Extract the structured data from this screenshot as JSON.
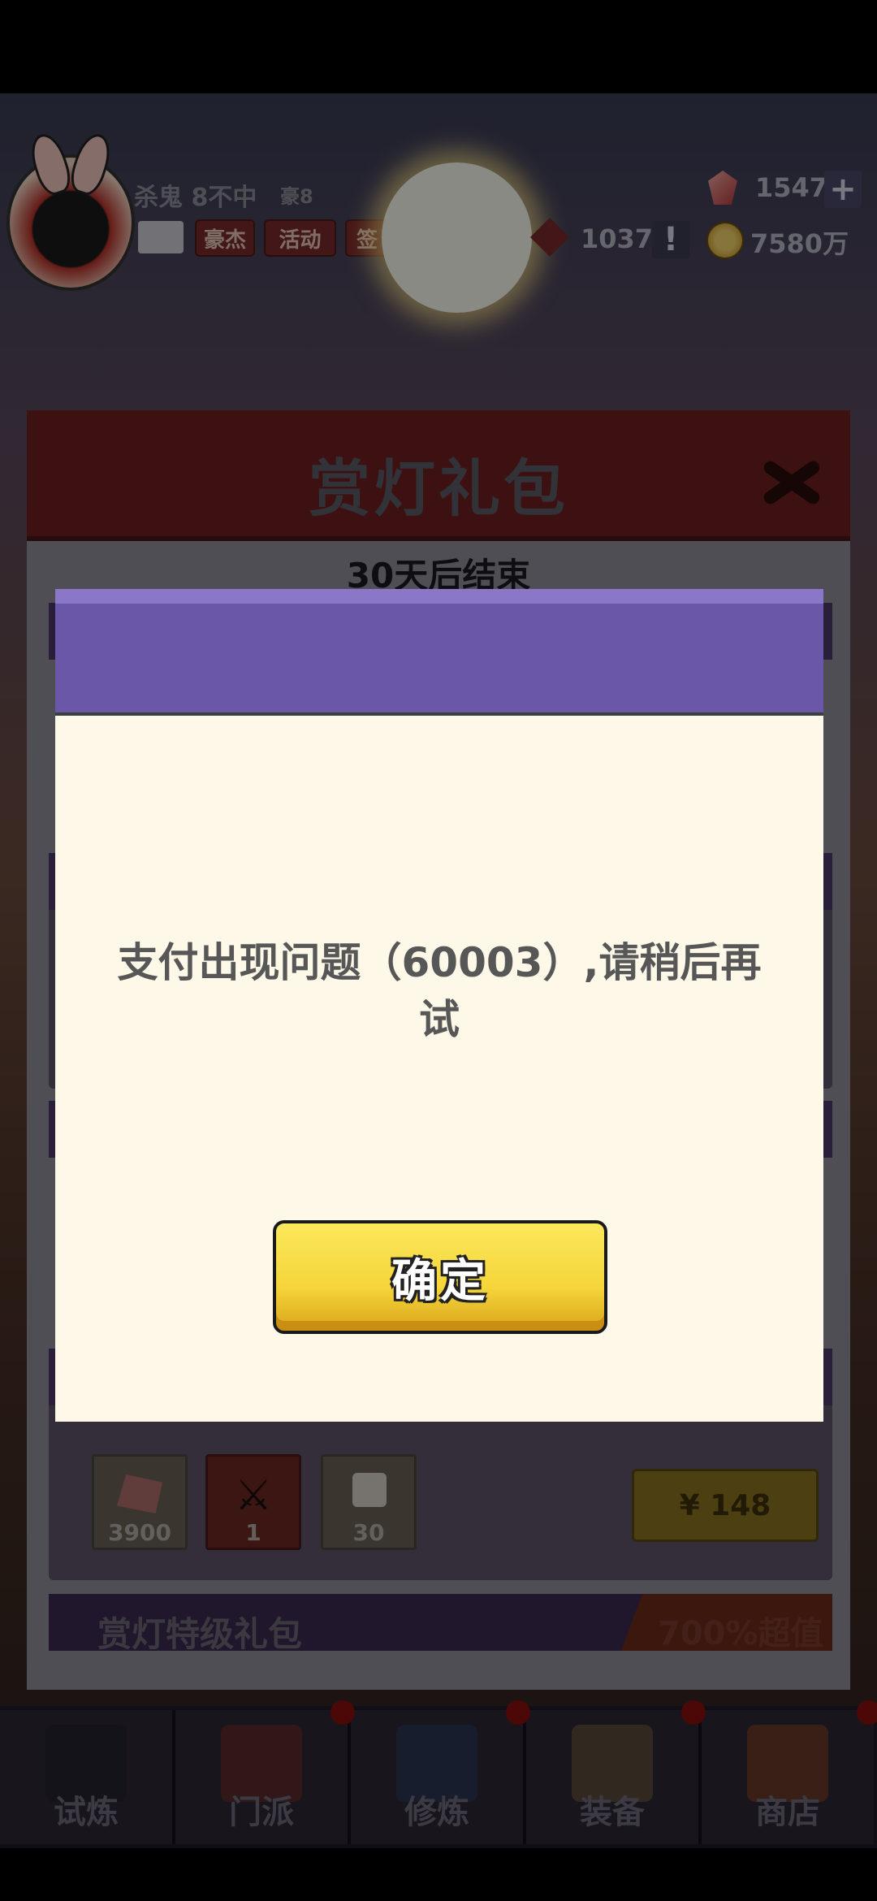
{
  "player": {
    "name": "杀鬼 8不中",
    "vip": "豪8",
    "chips": [
      "豪杰",
      "活动",
      "签"
    ]
  },
  "currencies": {
    "gems": "1547",
    "tokens": "1037",
    "coins": "7580万"
  },
  "background_popup": {
    "title": "赏灯礼包",
    "subtitle": "30天后结束",
    "visible_pack": {
      "items": [
        {
          "icon": "gem-icon",
          "count": "3900"
        },
        {
          "icon": "mystery-weapon-icon",
          "count": "1"
        },
        {
          "icon": "dice-icon",
          "count": "30"
        }
      ],
      "price": "¥ 148"
    },
    "special_pack": {
      "label": "赏灯特级礼包",
      "value": "700%超值"
    }
  },
  "bottom_nav": [
    {
      "label": "试炼",
      "icon": "ninja-icon"
    },
    {
      "label": "门派",
      "icon": "temple-icon"
    },
    {
      "label": "修炼",
      "icon": "scroll-book-icon"
    },
    {
      "label": "装备",
      "icon": "sword-icon"
    },
    {
      "label": "商店",
      "icon": "shop-icon"
    }
  ],
  "dialog": {
    "message": "支付出现问题（60003）,请稍后再试",
    "confirm_label": "确定"
  },
  "colors": {
    "dialog_header": "#6a57a7",
    "dialog_body": "#fef8e8",
    "confirm_button": "#f5d53a"
  }
}
